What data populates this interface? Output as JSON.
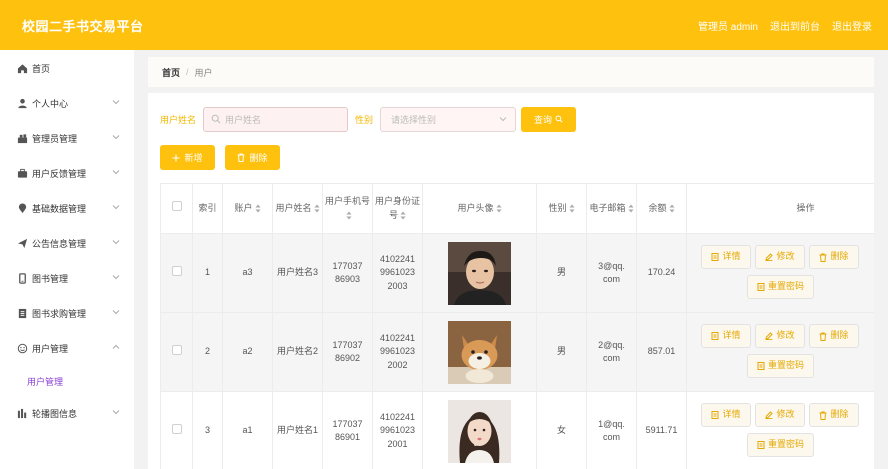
{
  "app": {
    "title": "校园二手书交易平台",
    "admin_label": "管理员 admin",
    "front_link": "退出到前台",
    "logout_link": "退出登录"
  },
  "sidebar": {
    "items": [
      {
        "label": "首页",
        "icon": "home-icon"
      },
      {
        "label": "个人中心",
        "icon": "person-icon"
      },
      {
        "label": "管理员管理",
        "icon": "admin-icon"
      },
      {
        "label": "用户反馈管理",
        "icon": "briefcase-icon"
      },
      {
        "label": "基础数据管理",
        "icon": "pin-icon"
      },
      {
        "label": "公告信息管理",
        "icon": "send-icon"
      },
      {
        "label": "图书管理",
        "icon": "book-icon"
      },
      {
        "label": "图书求购管理",
        "icon": "doc-icon"
      },
      {
        "label": "用户管理",
        "icon": "smile-icon"
      },
      {
        "label": "轮播图信息",
        "icon": "chart-icon"
      }
    ],
    "submenu_active": "用户管理"
  },
  "breadcrumb": {
    "home": "首页",
    "separator": "/",
    "current": "用户"
  },
  "filter": {
    "name_label": "用户姓名",
    "name_placeholder": "用户姓名",
    "gender_label": "性别",
    "gender_placeholder": "请选择性别",
    "query_button": "查询"
  },
  "toolbar": {
    "add_button": "新增",
    "delete_button": "删除"
  },
  "table": {
    "headers": {
      "index": "索引",
      "account": "账户",
      "name": "用户姓名",
      "phone": "用户手机号",
      "idcard": "用户身份证号",
      "avatar": "用户头像",
      "gender": "性别",
      "email": "电子邮箱",
      "balance": "余额",
      "ops": "操作"
    },
    "rows": [
      {
        "index": "1",
        "account": "a3",
        "name": "用户姓名3",
        "phone": "17703786903",
        "idcard": "410224199610232003",
        "avatar": "young-man-portrait",
        "gender": "男",
        "email": "3@qq.com",
        "balance": "170.24"
      },
      {
        "index": "2",
        "account": "a2",
        "name": "用户姓名2",
        "phone": "17703786902",
        "idcard": "410224199610232002",
        "avatar": "shiba-dog-photo",
        "gender": "男",
        "email": "2@qq.com",
        "balance": "857.01"
      },
      {
        "index": "3",
        "account": "a1",
        "name": "用户姓名1",
        "phone": "17703786901",
        "idcard": "410224199610232001",
        "avatar": "young-woman-portrait",
        "gender": "女",
        "email": "1@qq.com",
        "balance": "5911.71"
      }
    ],
    "row_actions": {
      "detail": "详情",
      "edit": "修改",
      "delete": "删除",
      "reset": "重置密码"
    }
  },
  "colors": {
    "accent": "#fec10d",
    "label": "#f3b800",
    "submenu": "#8a3fd1"
  }
}
